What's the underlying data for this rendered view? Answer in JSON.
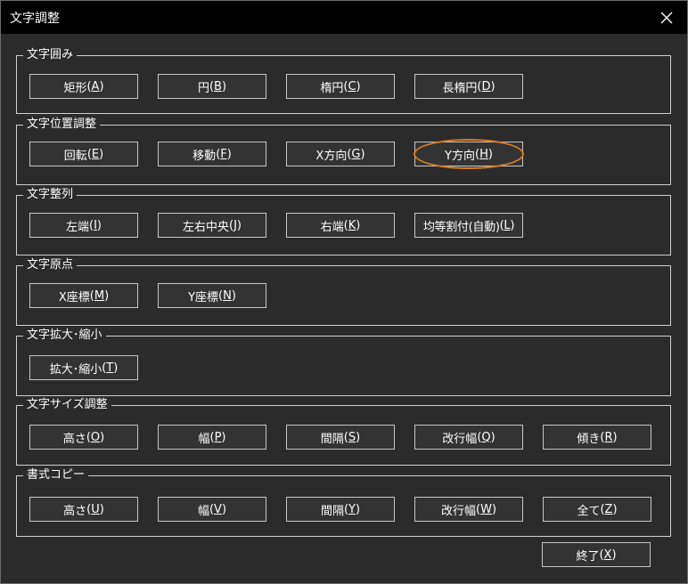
{
  "window": {
    "title": "文字調整",
    "close_icon": "close-icon"
  },
  "groups": [
    {
      "label": "文字囲み",
      "buttons": [
        {
          "text": "矩形",
          "key": "A"
        },
        {
          "text": "円",
          "key": "B"
        },
        {
          "text": "楕円",
          "key": "C"
        },
        {
          "text": "長楕円",
          "key": "D"
        }
      ]
    },
    {
      "label": "文字位置調整",
      "buttons": [
        {
          "text": "回転",
          "key": "E"
        },
        {
          "text": "移動",
          "key": "F"
        },
        {
          "text": "X方向",
          "key": "G"
        },
        {
          "text": "Y方向",
          "key": "H"
        }
      ]
    },
    {
      "label": "文字整列",
      "buttons": [
        {
          "text": "左端",
          "key": "I"
        },
        {
          "text": "左右中央",
          "key": "J"
        },
        {
          "text": "右端",
          "key": "K"
        },
        {
          "text": "均等割付(自動)",
          "key": "L"
        }
      ]
    },
    {
      "label": "文字原点",
      "buttons": [
        {
          "text": "X座標",
          "key": "M"
        },
        {
          "text": "Y座標",
          "key": "N"
        }
      ]
    },
    {
      "label": "文字拡大･縮小",
      "buttons": [
        {
          "text": "拡大･縮小",
          "key": "T"
        }
      ]
    },
    {
      "label": "文字サイズ調整",
      "buttons": [
        {
          "text": "高さ",
          "key": "O"
        },
        {
          "text": "幅",
          "key": "P"
        },
        {
          "text": "間隔",
          "key": "S"
        },
        {
          "text": "改行幅",
          "key": "Q"
        },
        {
          "text": "傾き",
          "key": "R"
        }
      ]
    },
    {
      "label": "書式コピー",
      "buttons": [
        {
          "text": "高さ",
          "key": "U"
        },
        {
          "text": "幅",
          "key": "V"
        },
        {
          "text": "間隔",
          "key": "Y"
        },
        {
          "text": "改行幅",
          "key": "W"
        },
        {
          "text": "全て",
          "key": "Z"
        }
      ]
    }
  ],
  "footer": {
    "exit": {
      "text": "終了",
      "key": "X"
    }
  },
  "colors": {
    "background": "#2b2b2b",
    "titlebar": "#000000",
    "highlight": "#e07a1f"
  }
}
